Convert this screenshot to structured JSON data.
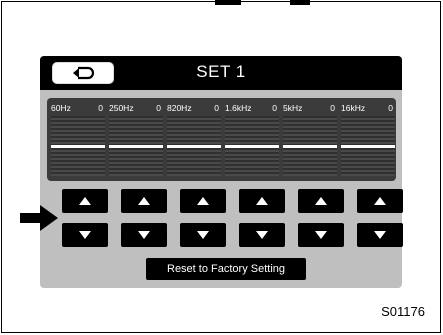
{
  "titlebar": {
    "title": "SET 1",
    "back_icon": "return-arrow-icon"
  },
  "bands": [
    {
      "label": "60Hz",
      "value": "0",
      "level": 0
    },
    {
      "label": "250Hz",
      "value": "0",
      "level": 0
    },
    {
      "label": "820Hz",
      "value": "0",
      "level": 0
    },
    {
      "label": "1.6kHz",
      "value": "0",
      "level": 0
    },
    {
      "label": "5kHz",
      "value": "0",
      "level": 0
    },
    {
      "label": "16kHz",
      "value": "0",
      "level": 0
    }
  ],
  "buttons": {
    "up_icon": "up-triangle-icon",
    "down_icon": "down-triangle-icon",
    "reset_label": "Reset to Factory Setting"
  },
  "pointer_icon": "right-arrow-pointer-icon",
  "figure_code": "S01176",
  "colors": {
    "screen_bg": "#bfbfbf",
    "panel_bg": "#3b3b3b",
    "button_bg": "#000000",
    "text_light": "#ffffff"
  }
}
